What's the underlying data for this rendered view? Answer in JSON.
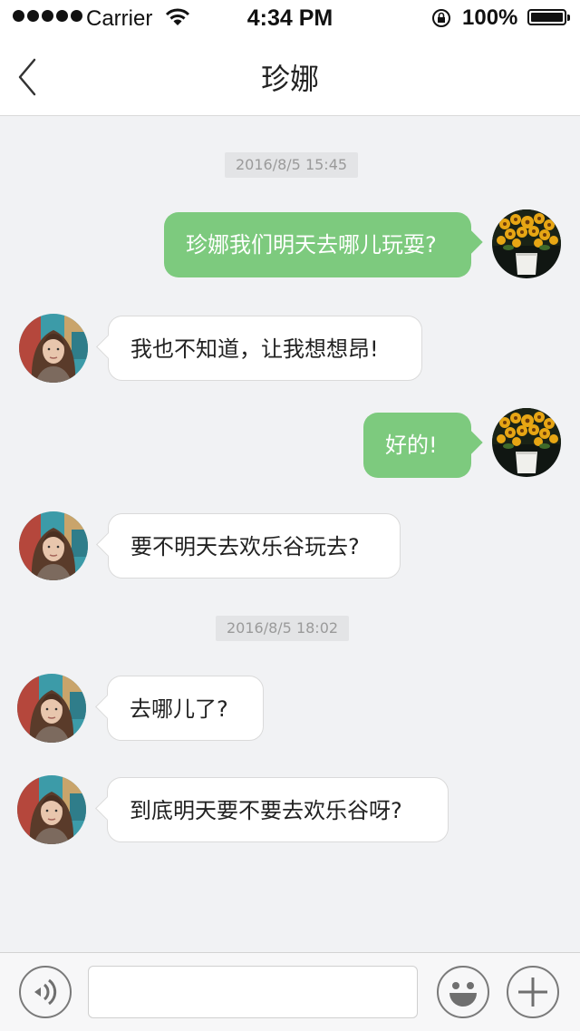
{
  "status_bar": {
    "carrier": "Carrier",
    "time": "4:34 PM",
    "battery": "100%"
  },
  "nav": {
    "title": "珍娜"
  },
  "messages": [
    {
      "type": "timestamp",
      "text": "2016/8/5 15:45"
    },
    {
      "type": "message",
      "direction": "outgoing",
      "text": "珍娜我们明天去哪儿玩耍?",
      "avatar": "sunflower-avatar"
    },
    {
      "type": "message",
      "direction": "incoming",
      "text": "我也不知道，让我想想昂!",
      "avatar": "girl-avatar"
    },
    {
      "type": "message",
      "direction": "outgoing",
      "text": "好的!",
      "avatar": "sunflower-avatar"
    },
    {
      "type": "message",
      "direction": "incoming",
      "text": "要不明天去欢乐谷玩去?",
      "avatar": "girl-avatar"
    },
    {
      "type": "timestamp",
      "text": "2016/8/5 18:02"
    },
    {
      "type": "message",
      "direction": "incoming",
      "text": "去哪儿了?",
      "avatar": "girl-avatar"
    },
    {
      "type": "message",
      "direction": "incoming",
      "text": "到底明天要不要去欢乐谷呀?",
      "avatar": "girl-avatar"
    }
  ],
  "input_bar": {
    "placeholder": "",
    "value": ""
  },
  "colors": {
    "accent_green": "#7dca7e",
    "background": "#f1f2f4"
  },
  "icons": [
    "back-chevron-icon",
    "voice-icon",
    "emoji-icon",
    "plus-icon"
  ]
}
